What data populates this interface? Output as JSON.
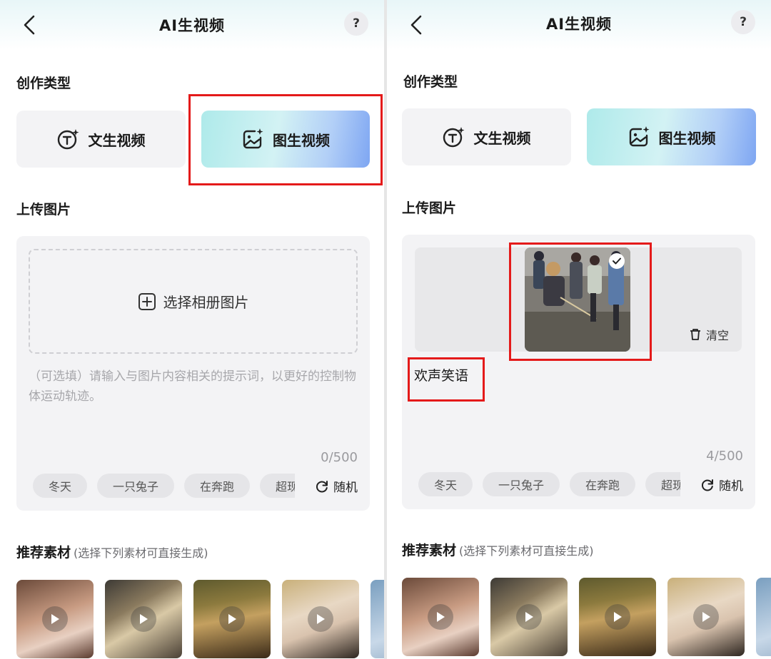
{
  "screens": [
    {
      "header": {
        "title": "AI生视频",
        "help_label": "?"
      },
      "creation_type": {
        "section_title": "创作类型",
        "options": [
          {
            "label": "文生视频",
            "icon": "text-to-video-icon",
            "selected": false
          },
          {
            "label": "图生视频",
            "icon": "image-to-video-icon",
            "selected": true
          }
        ]
      },
      "upload": {
        "section_title": "上传图片",
        "select_label": "选择相册图片",
        "prompt_placeholder": "（可选填）请输入与图片内容相关的提示词，以更好的控制物体运动轨迹。",
        "prompt_value": "",
        "counter": "0/500"
      },
      "chips": [
        "冬天",
        "一只兔子",
        "在奔跑",
        "超现实"
      ],
      "random_label": "随机",
      "recommended": {
        "title": "推荐素材",
        "hint": "(选择下列素材可直接生成)"
      }
    },
    {
      "header": {
        "title": "AI生视频",
        "help_label": "?"
      },
      "creation_type": {
        "section_title": "创作类型",
        "options": [
          {
            "label": "文生视频",
            "icon": "text-to-video-icon",
            "selected": false
          },
          {
            "label": "图生视频",
            "icon": "image-to-video-icon",
            "selected": true
          }
        ]
      },
      "upload": {
        "section_title": "上传图片",
        "clear_label": "清空",
        "prompt_value": "欢声笑语",
        "counter": "4/500"
      },
      "chips": [
        "冬天",
        "一只兔子",
        "在奔跑",
        "超现实"
      ],
      "random_label": "随机",
      "recommended": {
        "title": "推荐素材",
        "hint": "(选择下列素材可直接生成)"
      }
    }
  ],
  "colors": {
    "highlight_red": "#e41a1a",
    "active_gradient_start": "#aeeaea",
    "active_gradient_end": "#7ea6f2",
    "card_bg": "#f3f3f5"
  }
}
